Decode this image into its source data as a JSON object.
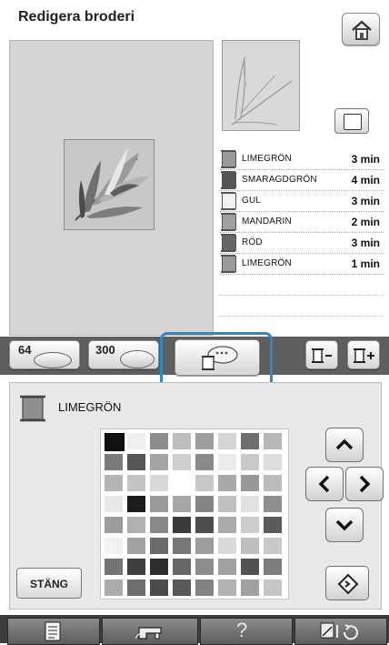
{
  "header": {
    "title": "Redigera broderi"
  },
  "threads": [
    {
      "name": "LIMEGRÖN",
      "time": "3 min",
      "color": "#9a9a9a"
    },
    {
      "name": "SMARAGDGRÖN",
      "time": "4 min",
      "color": "#555555"
    },
    {
      "name": "GUL",
      "time": "3 min",
      "color": "#f2f2f2"
    },
    {
      "name": "MANDARIN",
      "time": "2 min",
      "color": "#a0a0a0"
    },
    {
      "name": "RÖD",
      "time": "3 min",
      "color": "#666666"
    },
    {
      "name": "LIMEGRÖN",
      "time": "1 min",
      "color": "#9a9a9a"
    }
  ],
  "tabs": {
    "palette64": "64",
    "palette300": "300"
  },
  "selected": {
    "name": "LIMEGRÖN",
    "color": "#8f8f8f"
  },
  "panel": {
    "close_label": "STÄNG"
  },
  "palette_colors": [
    "#111111",
    "#f0f0f0",
    "#8c8c8c",
    "#bdbdbd",
    "#9e9e9e",
    "#d5d5d5",
    "#6e6e6e",
    "#b8b8b8",
    "#7a7a7a",
    "#555555",
    "#a4a4a4",
    "#cfcfcf",
    "#8a8a8a",
    "#ececec",
    "#cacaca",
    "#dedede",
    "#b5b5b5",
    "#c4c4c4",
    "#d9d9d9",
    "#ffffff",
    "#c8c8c8",
    "#a9a9a9",
    "#989898",
    "#bcbcbc",
    "#e8e8e8",
    "#1c1c1c",
    "#9a9a9a",
    "#a7a7a7",
    "#858585",
    "#c0c0c0",
    "#e2e2e2",
    "#8f8f8f",
    "#9c9c9c",
    "#b0b0b0",
    "#888888",
    "#3a3a3a",
    "#4d4d4d",
    "#aaaaaa",
    "#cccccc",
    "#5a5a5a",
    "#f2f2f2",
    "#a3a3a3",
    "#6b6b6b",
    "#777777",
    "#9d9d9d",
    "#dadada",
    "#bebebe",
    "#c9c9c9",
    "#747474",
    "#3f3f3f",
    "#2e2e2e",
    "#676767",
    "#8d8d8d",
    "#a1a1a1",
    "#525252",
    "#7d7d7d",
    "#ababab",
    "#6e6e6e",
    "#4a4a4a",
    "#595959",
    "#838383",
    "#b3b3b3",
    "#a0a0a0",
    "#c6c6c6"
  ]
}
